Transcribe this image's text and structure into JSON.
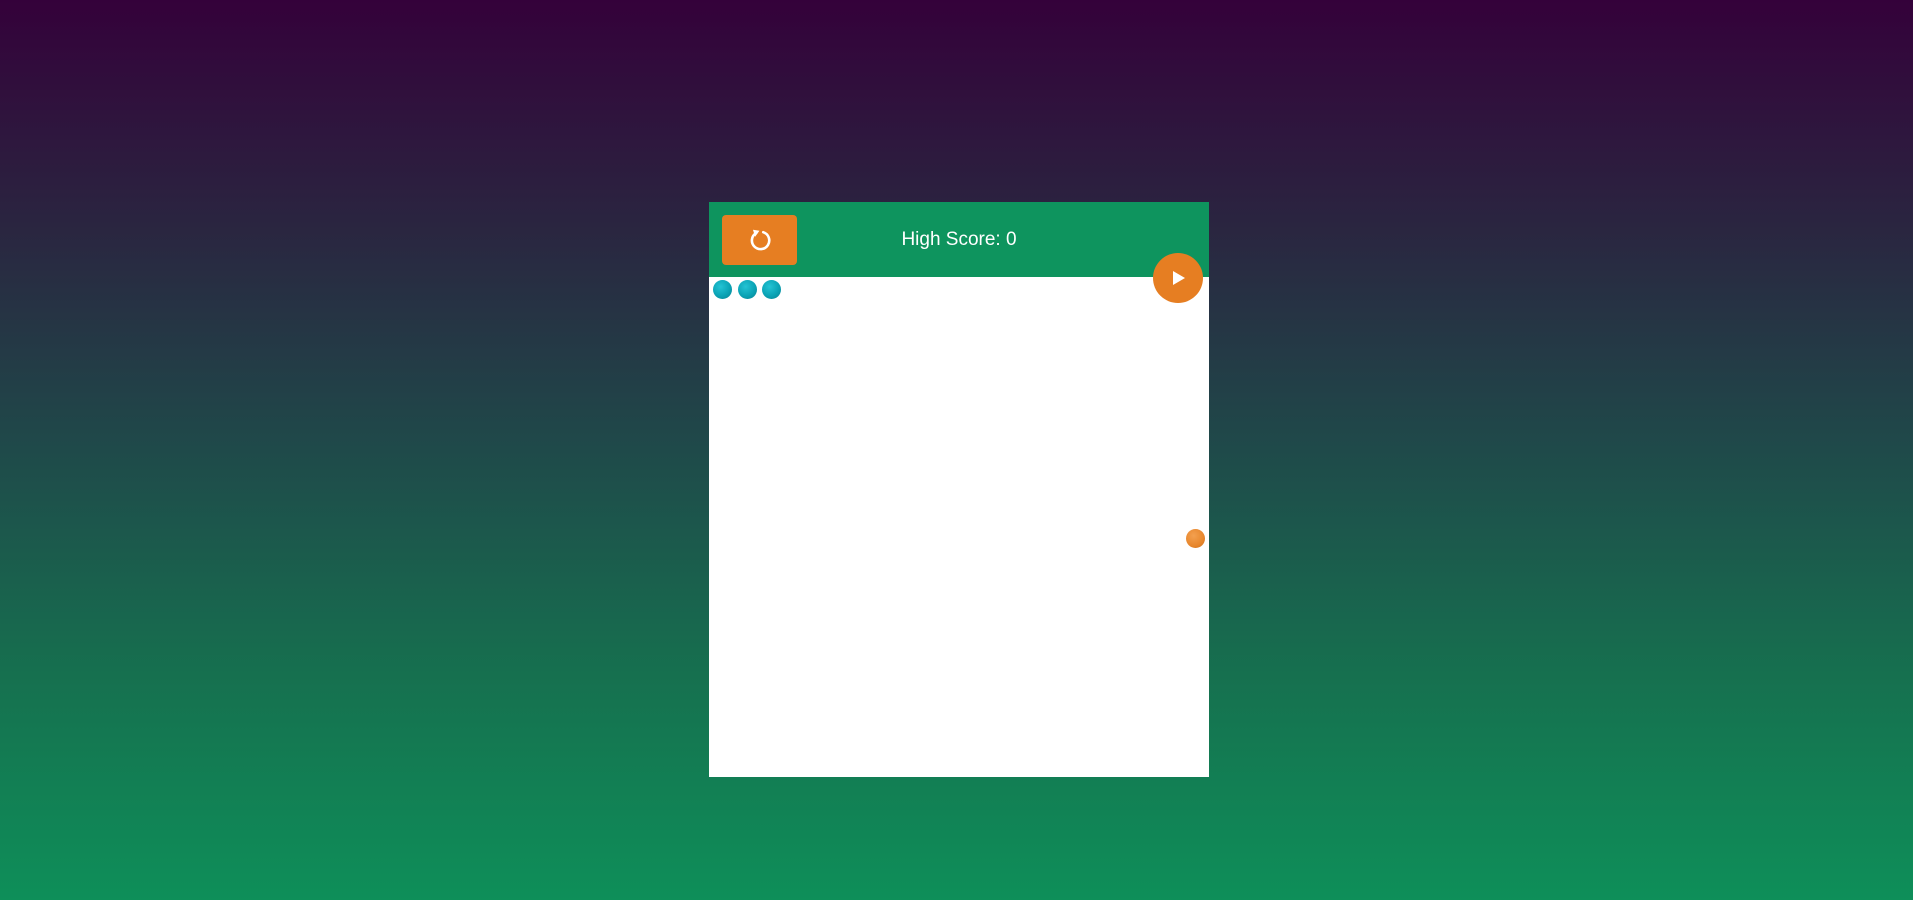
{
  "header": {
    "score_label": "High Score: 0",
    "restart_icon": "restart-icon",
    "play_icon": "play-icon"
  },
  "game": {
    "lives_remaining": 3,
    "ball_colors": {
      "lives": "#0aa3b5",
      "target": "#e8872d"
    }
  },
  "colors": {
    "header_bg": "#0e945e",
    "button_bg": "#e67e22",
    "board_bg": "#ffffff"
  }
}
